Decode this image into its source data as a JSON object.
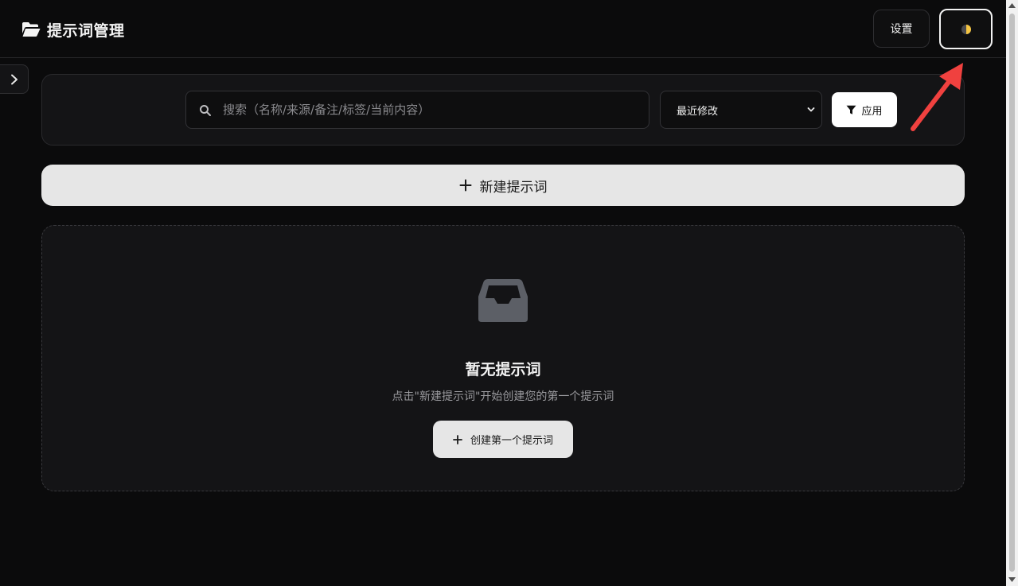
{
  "header": {
    "title": "提示词管理",
    "settings_label": "设置",
    "folder_icon": "folder-open-icon",
    "theme_icon": "half-moon-icon"
  },
  "sidebar": {
    "toggle_icon": "chevron-right-icon"
  },
  "filter": {
    "search_placeholder": "搜索（名称/来源/备注/标签/当前内容）",
    "search_value": "",
    "sort_selected": "最近修改",
    "apply_label": "应用",
    "search_icon": "search-icon",
    "apply_icon": "filter-icon"
  },
  "actions": {
    "new_prompt_label": "新建提示词",
    "new_prompt_icon": "plus-icon"
  },
  "empty_state": {
    "icon": "inbox-icon",
    "title": "暂无提示词",
    "description": "点击\"新建提示词\"开始创建您的第一个提示词",
    "button_label": "创建第一个提示词"
  },
  "colors": {
    "background": "#0b0b0c",
    "panel": "#141416",
    "button_light": "#e6e6e6",
    "annotation_arrow": "#f0413f",
    "theme_dot_light": "#f5c542",
    "theme_dot_dark": "#4a4a4e"
  }
}
